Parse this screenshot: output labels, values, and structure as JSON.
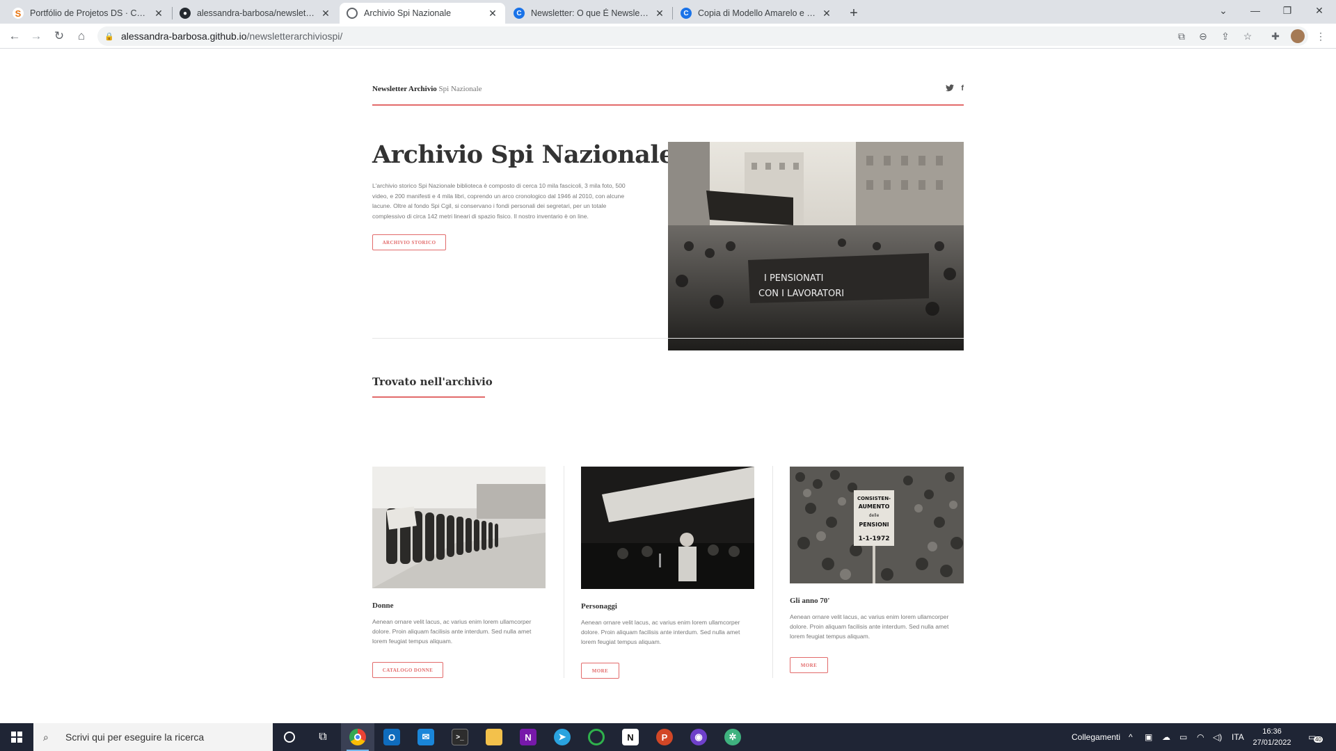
{
  "browser": {
    "tabs": [
      {
        "title": "Portfólio de Projetos DS · Comun",
        "icon": "portfolio-favicon",
        "color": "#e8710a",
        "glyph": "S"
      },
      {
        "title": "alessandra-barbosa/newsletterar",
        "icon": "github-favicon",
        "color": "#24292f",
        "glyph": "◉"
      },
      {
        "title": "Archivio Spi Nazionale",
        "icon": "globe-favicon",
        "color": "#5f6368",
        "glyph": "◎"
      },
      {
        "title": "Newsletter: O que É Newsletter?",
        "icon": "canva-favicon",
        "color": "#1a73e8",
        "glyph": "C"
      },
      {
        "title": "Copia di Modello Amarelo e Bran",
        "icon": "canva-favicon",
        "color": "#1a73e8",
        "glyph": "C"
      }
    ],
    "url_host": "alessandra-barbosa.github.io",
    "url_path": "/newsletterarchiviospi/"
  },
  "site": {
    "brand_bold": "Newsletter Archivio",
    "brand_sub": "Spi Nazionale",
    "social_twitter": "🐦",
    "social_facebook": "f"
  },
  "hero": {
    "title": "Archivio Spi Nazionale",
    "text": "L'archivio storico Spi Nazionale biblioteca è composto di cerca 10 mila fascicoli, 3 mila foto, 500 video, e 200 manifesti e 4 mila libri, coprendo un arco cronologico dal 1946 al 2010, con alcune lacune. Oltre al fondo Spi Cgil, si conservano i fondi personali dei segretari, per un totale complessivo di circa 142 metri lineari di spazio fisico. Il nostro inventario è on line.",
    "button": "ARCHIVIO STORICO",
    "banner1": "I PENSIONATI",
    "banner2": "CON I LAVORATORI"
  },
  "section": {
    "title": "Trovato nell'archivio"
  },
  "cards": [
    {
      "title": "Donne",
      "text": "Aenean ornare velit lacus, ac varius enim lorem ullamcorper dolore. Proin aliquam facilisis ante interdum. Sed nulla amet lorem feugiat tempus aliquam.",
      "button": "CATALOGO DONNE"
    },
    {
      "title": "Personaggi",
      "text": "Aenean ornare velit lacus, ac varius enim lorem ullamcorper dolore. Proin aliquam facilisis ante interdum. Sed nulla amet lorem feugiat tempus aliquam.",
      "button": "MORE"
    },
    {
      "title": "Gli anno 70'",
      "text": "Aenean ornare velit lacus, ac varius enim lorem ullamcorper dolore. Proin aliquam facilisis ante interdum. Sed nulla amet lorem feugiat tempus aliquam.",
      "button": "MORE",
      "sign": "CONSISTENTE AUMENTO delle PENSIONI dal 1-1-1972"
    }
  ],
  "taskbar": {
    "search_placeholder": "Scrivi qui per eseguire la ricerca",
    "links_label": "Collegamenti",
    "language": "ITA",
    "time": "16:36",
    "date": "27/01/2022",
    "notifications": "40"
  },
  "colors": {
    "accent": "#e26a6a",
    "text": "#333333",
    "muted": "#777777"
  }
}
